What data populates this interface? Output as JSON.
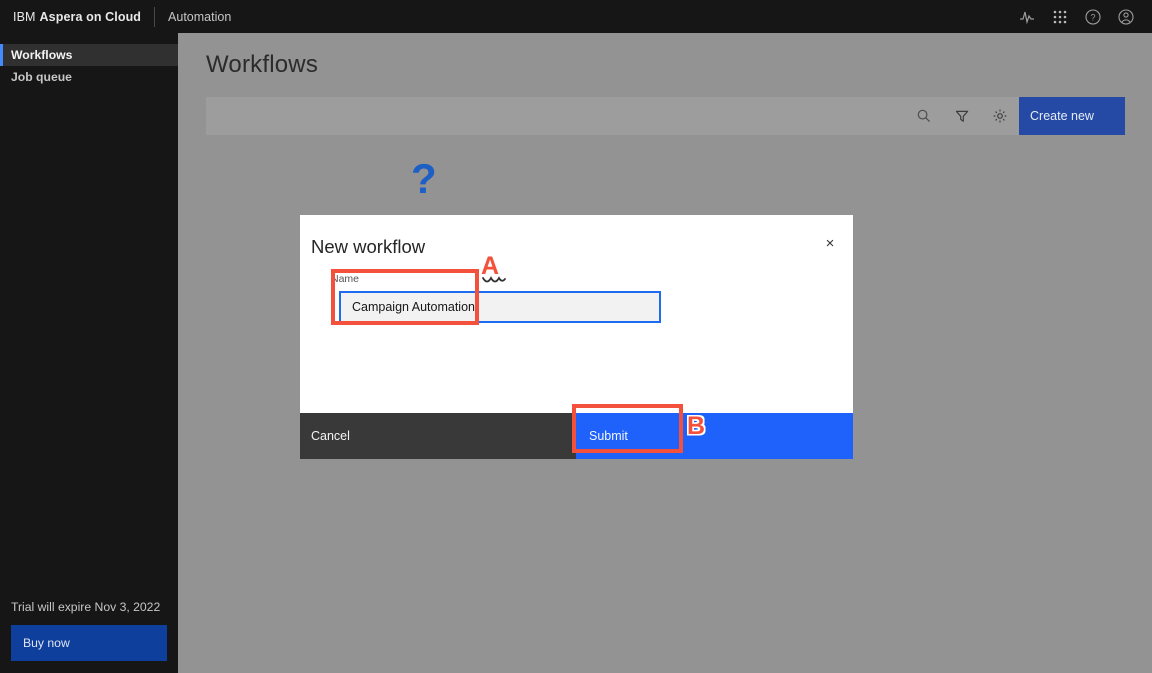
{
  "header": {
    "brand_light": "IBM",
    "brand_bold": "Aspera on Cloud",
    "app_name": "Automation",
    "actions": [
      {
        "name": "activity-icon",
        "label": "Activity"
      },
      {
        "name": "app-switcher-icon",
        "label": "App switcher"
      },
      {
        "name": "help-icon",
        "label": "Help"
      },
      {
        "name": "account-icon",
        "label": "Account"
      }
    ]
  },
  "sidebar": {
    "items": [
      {
        "label": "Workflows",
        "active": true
      },
      {
        "label": "Job queue",
        "active": false
      }
    ],
    "trial": {
      "text": "Trial will expire Nov 3, 2022",
      "buy_label": "Buy now"
    }
  },
  "main": {
    "page_title": "Workflows",
    "toolbar": {
      "search_label": "Search",
      "filter_label": "Filter",
      "settings_label": "Settings",
      "create_label": "Create new"
    },
    "empty_state": {
      "question_mark": "?"
    }
  },
  "modal": {
    "title": "New workflow",
    "close_label": "×",
    "field_label": "Name",
    "field_value": "Campaign Automation",
    "field_placeholder": "",
    "cancel_label": "Cancel",
    "submit_label": "Submit"
  },
  "annotations": [
    {
      "letter": "A",
      "target": "name-input"
    },
    {
      "letter": "B",
      "target": "submit-button"
    }
  ],
  "colors": {
    "header_bg": "#161616",
    "sidebar_bg": "#161616",
    "accent_blue": "#4589ff",
    "create_blue": "#254aa5",
    "submit_blue": "#1f62fb",
    "buy_blue": "#0f3f9c",
    "annotation_red": "#f4513c",
    "canvas_gray": "#939393"
  }
}
